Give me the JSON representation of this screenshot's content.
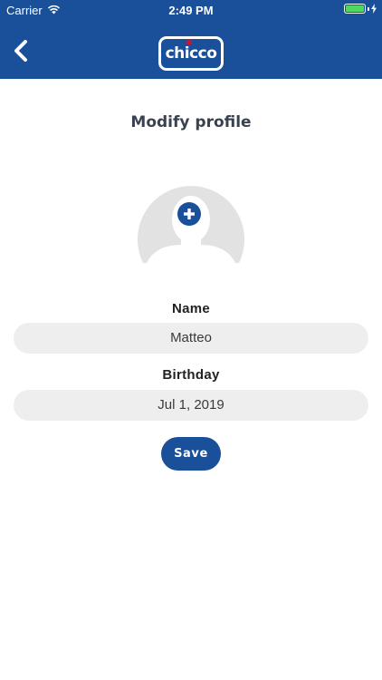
{
  "status_bar": {
    "carrier": "Carrier",
    "time": "2:49 PM",
    "wifi_icon": "wifi-icon",
    "battery_icon": "battery-charging-icon"
  },
  "header": {
    "back_icon": "chevron-left-icon",
    "logo_text": "chicco",
    "background_color": "#1a4f9a"
  },
  "page": {
    "title": "Modify profile"
  },
  "avatar": {
    "placeholder_icon": "person-silhouette-icon",
    "add_icon": "plus-circle-icon"
  },
  "form": {
    "name_label": "Name",
    "name_value": "Matteo",
    "birthday_label": "Birthday",
    "birthday_value": "Jul 1, 2019",
    "save_label": "Save"
  },
  "colors": {
    "accent": "#1a4f9a",
    "field_background": "#eeeeee",
    "title_text": "#3a4150"
  }
}
